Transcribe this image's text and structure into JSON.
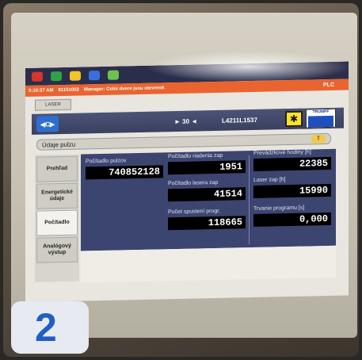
{
  "msgbar": {
    "time": "9:10:37 AM",
    "code": "81151002",
    "message": "Manager: Celni dvere jsou otevrené.",
    "plc": "PLC"
  },
  "tabs": {
    "laser": "LASER"
  },
  "nav": {
    "back_label": "◀C▶",
    "page_indicator": "► 30 ◄",
    "program_id": "L4211L1537",
    "laser_status_icon": "laser-icon",
    "trumpf_label": "TRUMPF"
  },
  "section": {
    "title": "Údaje pulzu",
    "arrow": "⇧"
  },
  "sidebar": {
    "items": [
      {
        "label": "Prehľad"
      },
      {
        "label": "Energetické údaje"
      },
      {
        "label": "Počítadlo"
      },
      {
        "label": "Analógový výstup"
      }
    ]
  },
  "counters": {
    "pulse_counter": {
      "label": "Počítadlo pulzov",
      "value": "740852128"
    },
    "control_counter": {
      "label": "Počítadlo riadenia zap",
      "value": "1951"
    },
    "laser_counter": {
      "label": "Počítadlo lasera zap",
      "value": "41514"
    },
    "program_starts": {
      "label": "Počet spustení progr.",
      "value": "118665"
    },
    "operating_hours": {
      "label": "Prevádzkové hodiny [h]",
      "value": "22385"
    },
    "laser_on": {
      "label": "Laser zap [h]",
      "value": "15990"
    },
    "program_duration": {
      "label": "Trvanie programu [s]",
      "value": "0,000"
    }
  },
  "badge": {
    "number": "2"
  },
  "colors": {
    "accent": "#1f5fc4",
    "panel": "#3c4570",
    "message": "#e9642f",
    "status_yellow": "#ffe12b"
  }
}
